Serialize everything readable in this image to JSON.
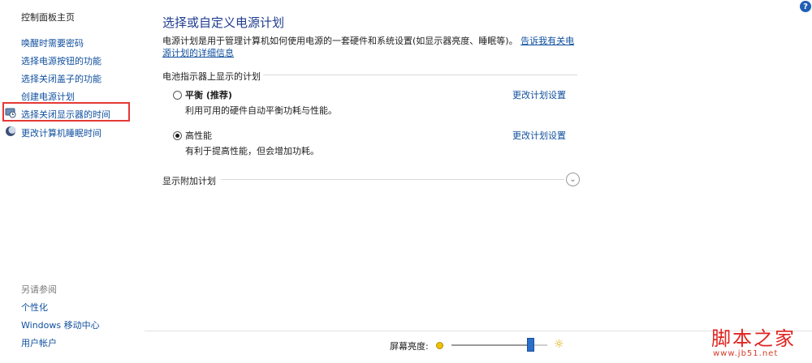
{
  "sidebar": {
    "home": "控制面板主页",
    "links": [
      "唤醒时需要密码",
      "选择电源按钮的功能",
      "选择关闭盖子的功能",
      "创建电源计划",
      "选择关闭显示器的时间",
      "更改计算机睡眠时间"
    ],
    "see_also": "另请参阅",
    "see_also_links": [
      "个性化",
      "Windows 移动中心",
      "用户帐户"
    ]
  },
  "main": {
    "title": "选择或自定义电源计划",
    "desc_text": "电源计划是用于管理计算机如何使用电源的一套硬件和系统设置(如显示器亮度、睡眠等)。",
    "desc_link": "告诉我有关电源计划的详细信息",
    "battery_section": "电池指示器上显示的计划",
    "plans": [
      {
        "name": "平衡 (推荐)",
        "desc": "利用可用的硬件自动平衡功耗与性能。",
        "change": "更改计划设置",
        "selected": false
      },
      {
        "name": "高性能",
        "desc": "有利于提高性能，但会增加功耗。",
        "change": "更改计划设置",
        "selected": true
      }
    ],
    "extra_section": "显示附加计划"
  },
  "help": "?",
  "bottom": {
    "brightness_label": "屏幕亮度:",
    "brightness_level": 0.85
  },
  "watermark": {
    "title": "脚本之家",
    "url": "www.jb51.net"
  },
  "colors": {
    "link": "#0f4f9e",
    "title": "#1f3d8f",
    "highlight": "#e53935",
    "watermark": "#e0241f"
  }
}
